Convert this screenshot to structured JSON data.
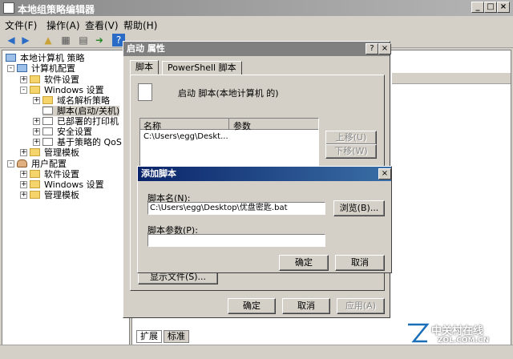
{
  "window": {
    "title": "本地组策略编辑器"
  },
  "menu": [
    "文件(F)",
    "操作(A)",
    "查看(V)",
    "帮助(H)"
  ],
  "tree": {
    "root": "本地计算机 策略",
    "computer": "计算机配置",
    "software": "软件设置",
    "windows": "Windows 设置",
    "dns": "域名解析策略",
    "scripts": "脚本(启动/关机)",
    "printers": "已部署的打印机",
    "security": "安全设置",
    "qos": "基于策略的 QoS",
    "admin": "管理模板",
    "user": "用户配置",
    "u_software": "软件设置",
    "u_windows": "Windows 设置",
    "u_admin": "管理模板"
  },
  "bottom_tabs": [
    "扩展",
    "标准"
  ],
  "props": {
    "title": "启动 属性",
    "tabs": [
      "脚本",
      "PowerShell 脚本"
    ],
    "heading": "启动 脚本(本地计算机 的)",
    "col_name": "名称",
    "col_param": "参数",
    "row1": "C:\\Users\\egg\\Deskt...",
    "up": "上移(U)",
    "down": "下移(W)",
    "show_files": "显示文件(S)...",
    "ok": "确定",
    "cancel": "取消",
    "apply": "应用(A)"
  },
  "add": {
    "title": "添加脚本",
    "name_label": "脚本名(N):",
    "name_value": "C:\\Users\\egg\\Desktop\\优盘密匙.bat",
    "browse": "浏览(B)...",
    "param_label": "脚本参数(P):",
    "param_value": "",
    "ok": "确定",
    "cancel": "取消"
  },
  "watermark": {
    "brand": "中关村在线",
    "site": "ZOL.COM.CN"
  },
  "colors": {
    "active_title": "#0a246a",
    "inactive_title": "#808080",
    "selection": "#d4d0c8"
  }
}
